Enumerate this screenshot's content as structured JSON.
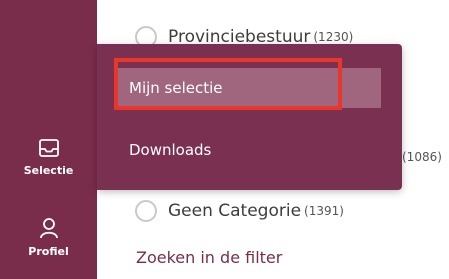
{
  "sidebar": {
    "items": [
      {
        "label": "Selectie",
        "icon": "inbox-icon",
        "active": true
      },
      {
        "label": "Profiel",
        "icon": "user-icon",
        "active": false
      }
    ]
  },
  "filters": {
    "items": [
      {
        "name": "Provinciebestuur",
        "count": "(1230)"
      },
      {
        "name": "Geen Categorie",
        "count": "(1391)"
      }
    ],
    "partial_count": "(1086)",
    "search_link": "Zoeken in de filter"
  },
  "popup_menu": {
    "items": [
      {
        "label": "Mijn selectie",
        "selected": true
      },
      {
        "label": "Downloads",
        "selected": false
      }
    ]
  },
  "colors": {
    "brand": "#7a2d4a",
    "popup_bg": "#7a3050",
    "selected_bg": "#a0667d",
    "highlight": "#e8372a"
  }
}
